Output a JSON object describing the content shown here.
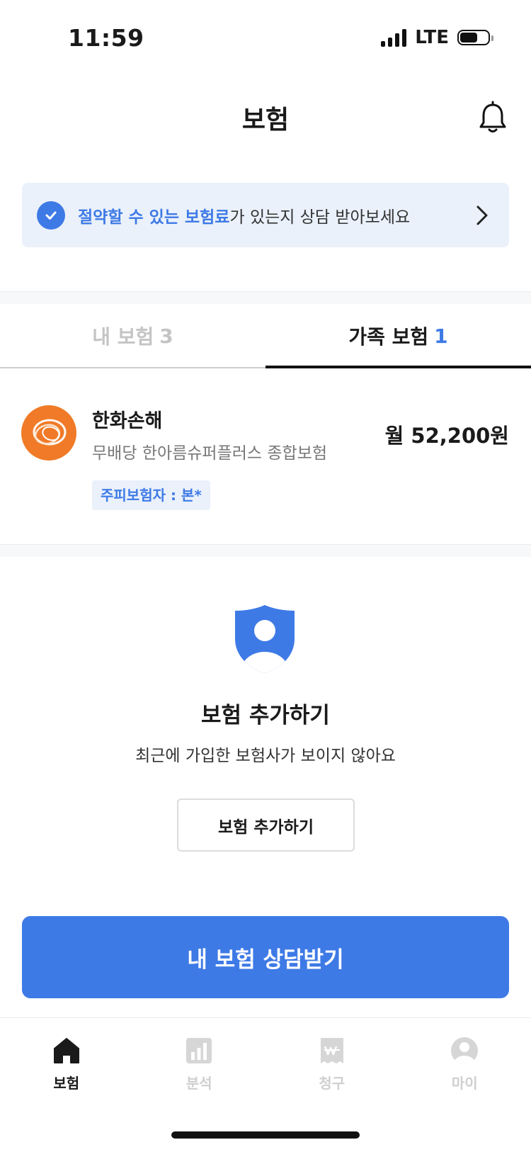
{
  "status_bar": {
    "time": "11:59",
    "network": "LTE",
    "battery_level": 0.62
  },
  "header": {
    "title": "보험",
    "bell_icon": "bell-icon"
  },
  "banner": {
    "highlight": "절약할 수 있는 보험료",
    "text": "가 있는지 상담 받아보세요",
    "check_icon": "check-circle-icon",
    "arrow_icon": "chevron-right-icon"
  },
  "tabs": [
    {
      "label": "내 보험",
      "count": "3",
      "active": false
    },
    {
      "label": "가족 보험",
      "count": "1",
      "active": true
    }
  ],
  "insurance_item": {
    "company": "한화손해",
    "product": "무배당 한아름슈퍼플러스 종합보험",
    "badge": "주피보험자 : 본*",
    "price": "월 52,200원",
    "logo_color": "#f07a27"
  },
  "add_section": {
    "icon": "shield-user-icon",
    "title": "보험 추가하기",
    "description": "최근에 가입한 보험사가 보이지 않아요",
    "button_label": "보험 추가하기"
  },
  "cta": {
    "label": "내 보험 상담받기"
  },
  "bottom_nav": [
    {
      "label": "보험",
      "icon": "home-icon",
      "active": true
    },
    {
      "label": "분석",
      "icon": "chart-icon",
      "active": false
    },
    {
      "label": "청구",
      "icon": "won-receipt-icon",
      "active": false
    },
    {
      "label": "마이",
      "icon": "user-icon",
      "active": false
    }
  ],
  "colors": {
    "accent": "#3e7ae6",
    "banner_bg": "#eaf1fb",
    "inactive": "#cfcfcf"
  }
}
